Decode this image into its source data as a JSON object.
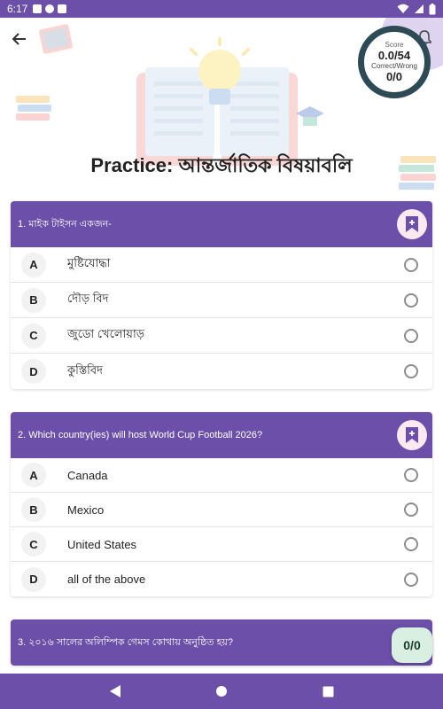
{
  "status_bar": {
    "time": "6:17",
    "background": "#6b4fa8"
  },
  "header": {
    "title": "Practice: আন্তর্জাতিক বিষয়াবলি",
    "back_icon": "arrow-left-icon",
    "bell_icon": "bell-icon"
  },
  "score": {
    "label": "Score",
    "value": "0.0/54",
    "sub_label": "Correct/Wrong",
    "correct_wrong": "0/0"
  },
  "questions": [
    {
      "text": "1. মাইক টাইসন একজন-",
      "options": [
        {
          "letter": "A",
          "text": "মুষ্টিযোদ্ধা"
        },
        {
          "letter": "B",
          "text": "দৌড় বিদ"
        },
        {
          "letter": "C",
          "text": "জুডো খেলোয়াড়"
        },
        {
          "letter": "D",
          "text": "কুস্তিবিদ"
        }
      ]
    },
    {
      "text": "2. Which country(ies) will host World Cup Football 2026?",
      "options": [
        {
          "letter": "A",
          "text": "Canada"
        },
        {
          "letter": "B",
          "text": "Mexico"
        },
        {
          "letter": "C",
          "text": "United States"
        },
        {
          "letter": "D",
          "text": "all of the above"
        }
      ]
    },
    {
      "text": "3. ২০১৬ সালের অলিম্পিক গেমস কোথায় অনুষ্ঠিত হয়?",
      "options": []
    }
  ],
  "fab": {
    "counter": "0/0"
  },
  "colors": {
    "accent": "#6b4fa8",
    "ring": "#2d4a55",
    "bookmark_bg": "#fbe9f1",
    "fab_bg": "#d9efe1"
  }
}
